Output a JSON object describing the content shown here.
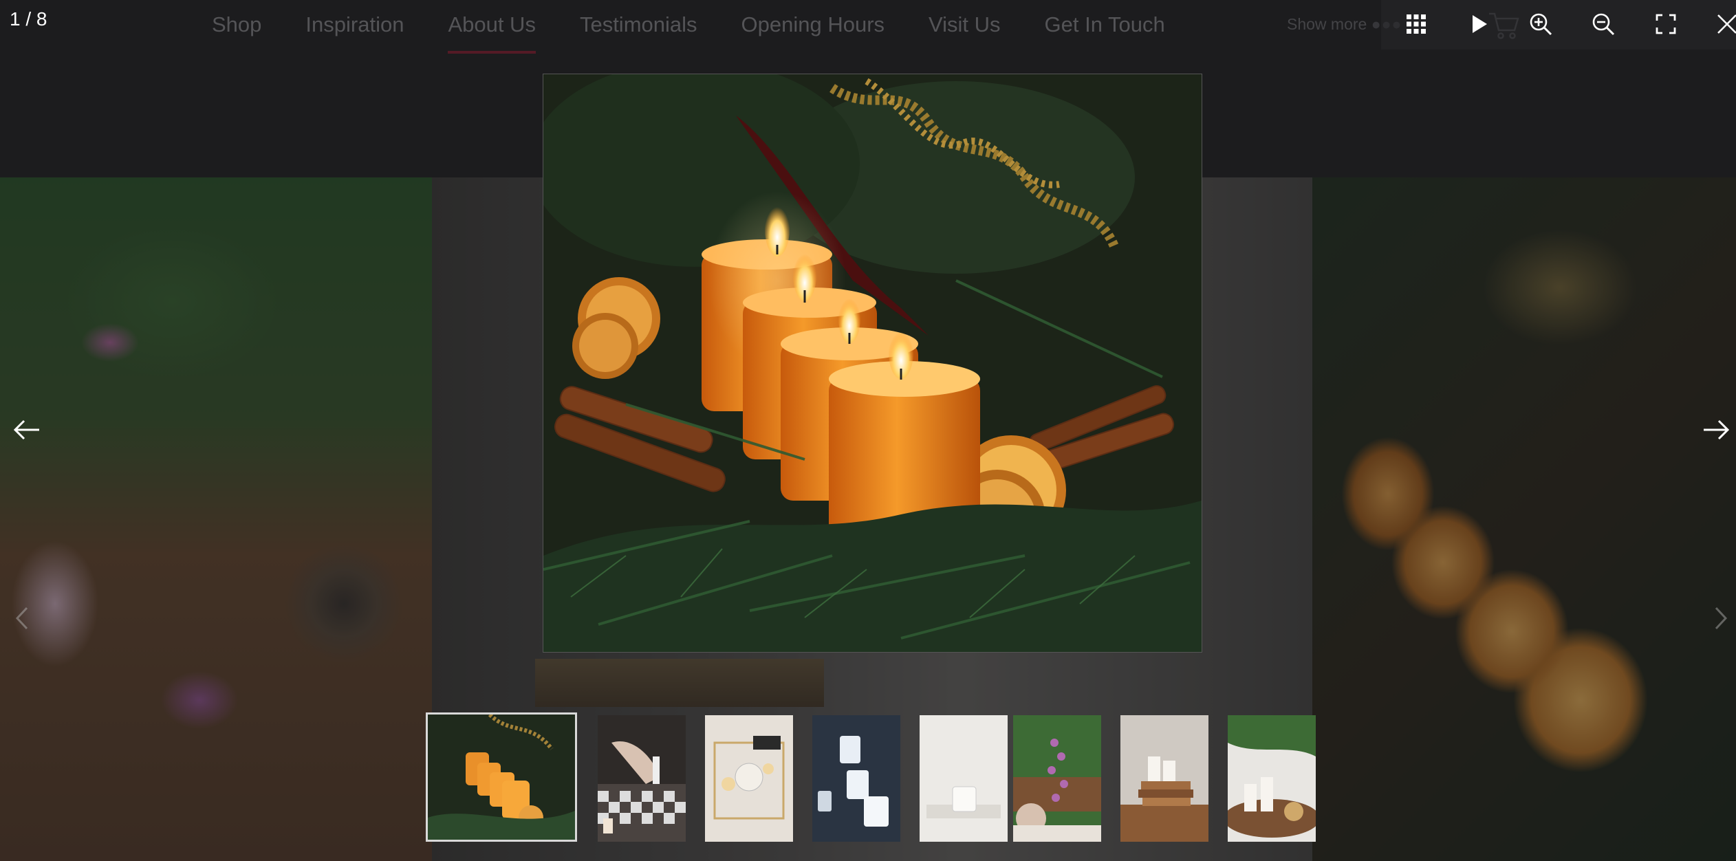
{
  "lightbox": {
    "counter": "1 / 8",
    "toolbar": {
      "thumbnails_icon": "grid-icon",
      "slideshow_icon": "play-icon",
      "zoom_in_icon": "zoom-in-icon",
      "zoom_out_icon": "zoom-out-icon",
      "fullscreen_icon": "fullscreen-icon",
      "close_icon": "close-icon"
    },
    "prev_icon": "arrow-left-icon",
    "next_icon": "arrow-right-icon",
    "current_index": 1,
    "total": 8,
    "thumbnails": [
      {
        "subject": "orange candles with pine and cinnamon"
      },
      {
        "subject": "hand lighting candles on tiled floor"
      },
      {
        "subject": "candles on tray with cup"
      },
      {
        "subject": "white candles in blue light"
      },
      {
        "subject": "single white candle on white"
      },
      {
        "subject": "lilac flowers with candle jar"
      },
      {
        "subject": "candles on stack of books"
      },
      {
        "subject": "candles on round wooden table"
      }
    ]
  },
  "site": {
    "nav": [
      {
        "label": "Shop"
      },
      {
        "label": "Inspiration"
      },
      {
        "label": "About Us",
        "active": true
      },
      {
        "label": "Testimonials"
      },
      {
        "label": "Opening Hours"
      },
      {
        "label": "Visit Us"
      },
      {
        "label": "Get In Touch"
      }
    ],
    "show_more": "Show more",
    "cart_icon": "cart-icon"
  },
  "colors": {
    "nav_active_underline": "#8e1f35",
    "overlay_bg": "#1e1e20"
  }
}
